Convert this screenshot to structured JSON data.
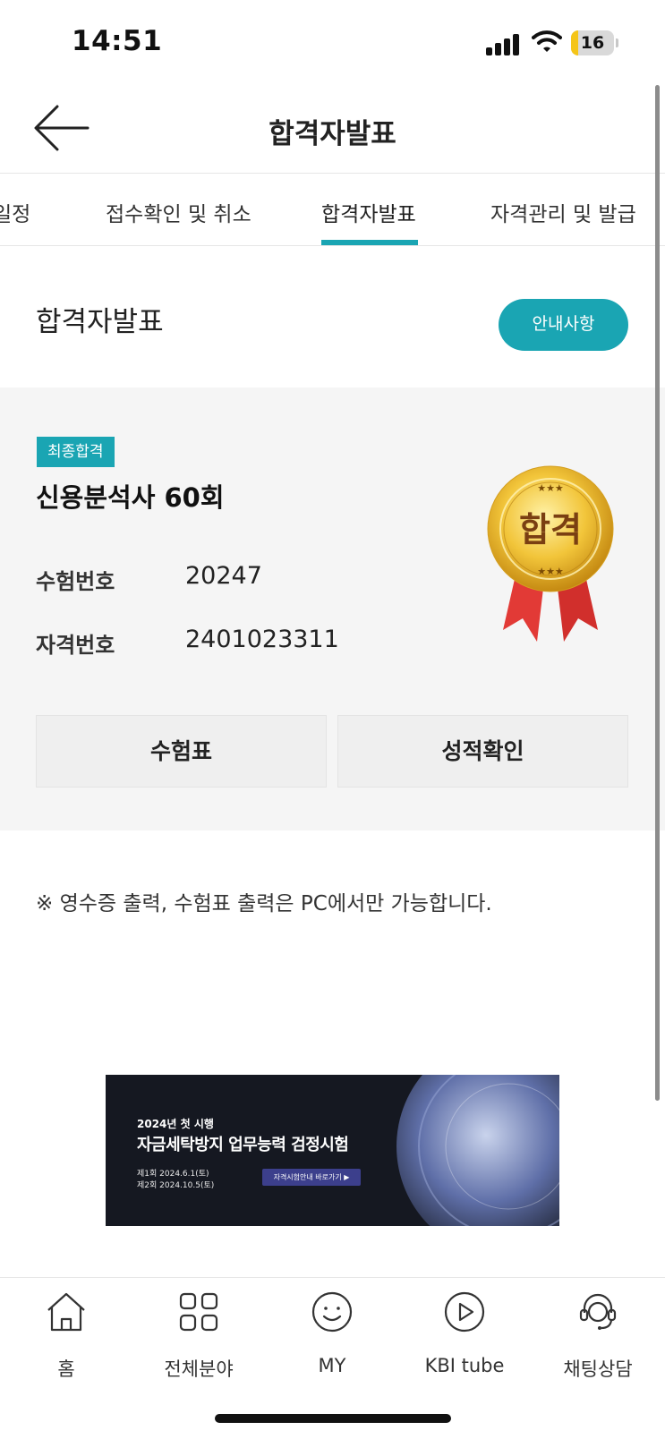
{
  "status_bar": {
    "time": "14:51",
    "battery_level": "16",
    "battery_fraction": 0.16,
    "icons": [
      "signal-icon",
      "wifi-icon",
      "battery-icon"
    ]
  },
  "header": {
    "back_icon": "arrow-left-icon",
    "title": "합격자발표"
  },
  "tabs": [
    {
      "label": "일정"
    },
    {
      "label": "접수확인 및 취소"
    },
    {
      "label": "합격자발표",
      "active": true
    },
    {
      "label": "자격관리 및 발급"
    }
  ],
  "section": {
    "title": "합격자발표",
    "notice_button": "안내사항"
  },
  "result": {
    "badge": "최종합격",
    "exam_name": "신용분석사 60회",
    "fields": [
      {
        "label": "수험번호",
        "value": "20247"
      },
      {
        "label": "자격번호",
        "value": "2401023311"
      }
    ],
    "medal_text": "합격",
    "buttons": {
      "ticket": "수험표",
      "score": "성적확인"
    }
  },
  "note": "※ 영수증 출력, 수험표 출력은 PC에서만 가능합니다.",
  "banner": {
    "year_line": "2024년 첫 시행",
    "title": "자금세탁방지 업무능력 검정시험",
    "date_1": "제1회 2024.6.1(토)",
    "date_2": "제2회 2024.10.5(토)",
    "cta": "자격시험안내 바로가기 ▶"
  },
  "bottom_nav": [
    {
      "label": "홈",
      "icon": "home-icon"
    },
    {
      "label": "전체분야",
      "icon": "grid-icon"
    },
    {
      "label": "MY",
      "icon": "smiley-icon"
    },
    {
      "label": "KBI tube",
      "icon": "play-icon"
    },
    {
      "label": "채팅상담",
      "icon": "headset-icon"
    }
  ],
  "colors": {
    "accent": "#1aa5b3",
    "card_bg": "#f5f5f5",
    "medal_gold": "#e8b52a",
    "ribbon_red": "#e23a36"
  }
}
